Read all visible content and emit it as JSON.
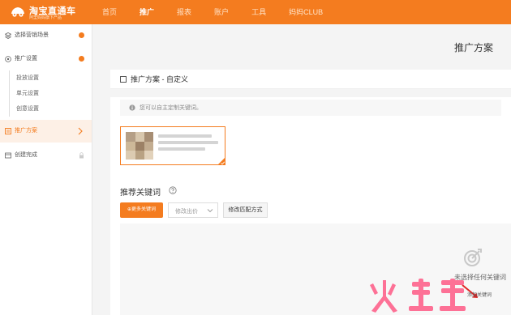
{
  "header": {
    "logo_title": "淘宝直通车",
    "logo_subtitle": "阿里妈妈旗下产品",
    "nav": [
      "首页",
      "推广",
      "报表",
      "账户",
      "工具",
      "妈妈CLUB"
    ],
    "active_nav": "推广"
  },
  "sidebar": {
    "items": [
      {
        "label": "选择营销场景",
        "icon": "layers-icon",
        "status": "done-dot"
      },
      {
        "label": "推广设置",
        "icon": "settings-circle-icon",
        "status": "done-dot"
      },
      {
        "label": "投放设置",
        "sub": true
      },
      {
        "label": "单元设置",
        "sub": true
      },
      {
        "label": "创意设置",
        "sub": true
      },
      {
        "label": "推广方案",
        "icon": "plan-icon",
        "active": true
      },
      {
        "label": "创建完成",
        "icon": "finish-icon",
        "status": "lock"
      }
    ]
  },
  "main": {
    "page_title": "推广方案",
    "section_title": "推广方案 - 自定义",
    "tip": "您可以自主定制关键词。",
    "recommend_title": "推荐关键词",
    "more_keywords_button": "⊕更多关键词",
    "bid_select_label": "修改出价",
    "match_button": "修改匹配方式",
    "empty_text": "未选择任何关键词",
    "add_keyword_label": "添加关键词"
  },
  "colors": {
    "brand_orange": "#f47c1f",
    "alert_red": "#e02424"
  }
}
